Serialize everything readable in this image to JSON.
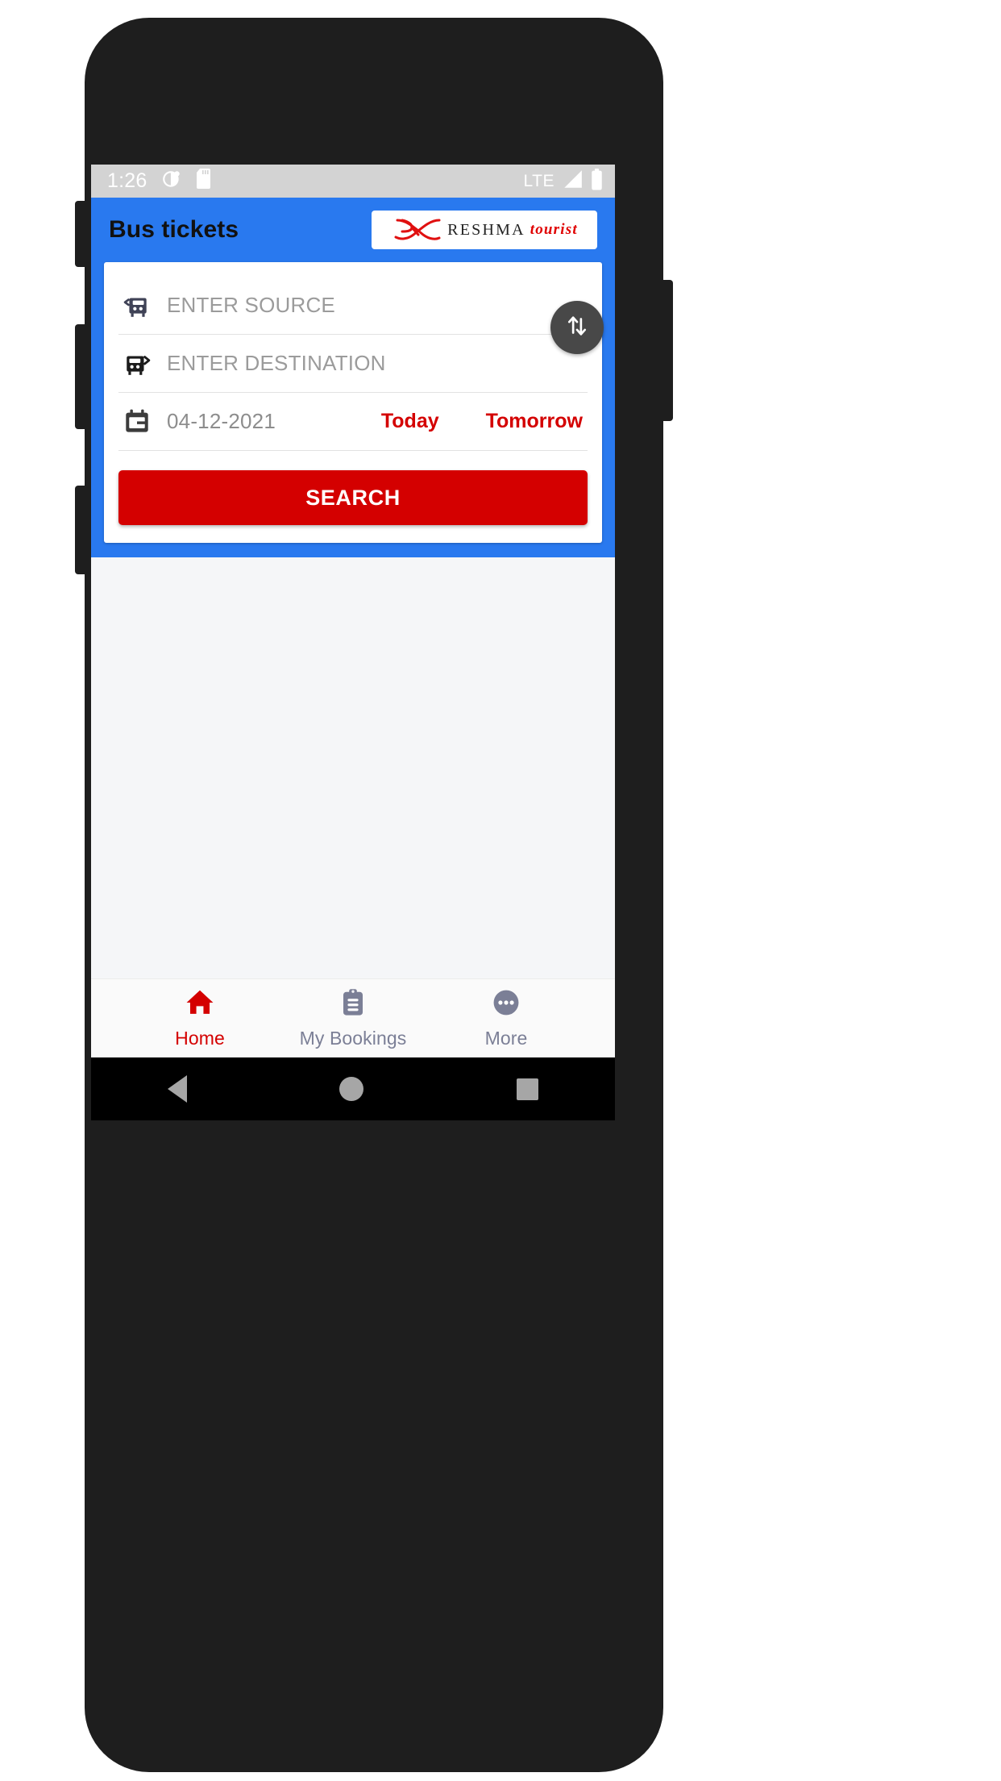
{
  "status_bar": {
    "time": "1:26",
    "network": "LTE",
    "icons": [
      "dnd-icon",
      "sd-card-icon",
      "signal-icon",
      "battery-icon"
    ]
  },
  "app_bar": {
    "title": "Bus tickets",
    "logo": {
      "mark": "reshma-monogram-icon",
      "name": "RESHMA",
      "suffix": "tourist"
    }
  },
  "search_card": {
    "source": {
      "icon": "bus-departure-icon",
      "value": "",
      "placeholder": "ENTER SOURCE"
    },
    "destination": {
      "icon": "bus-arrival-icon",
      "value": "",
      "placeholder": "ENTER DESTINATION"
    },
    "date": {
      "icon": "calendar-icon",
      "value": "04-12-2021"
    },
    "quick_dates": [
      {
        "label": "Today"
      },
      {
        "label": "Tomorrow"
      }
    ],
    "swap_button": {
      "icon": "swap-vertical-icon"
    },
    "search_button": {
      "label": "SEARCH"
    }
  },
  "bottom_nav": {
    "items": [
      {
        "label": "Home",
        "icon": "home-icon",
        "active": true
      },
      {
        "label": "My Bookings",
        "icon": "clipboard-icon",
        "active": false
      },
      {
        "label": "More",
        "icon": "more-dots-icon",
        "active": false
      }
    ]
  },
  "android_nav": {
    "back": "back-triangle-icon",
    "home": "home-circle-icon",
    "recents": "recents-square-icon"
  },
  "colors": {
    "primary_blue": "#2979ef",
    "accent_red": "#d40000",
    "status_bar": "#d3d3d3",
    "body_bg": "#f5f6f8",
    "nav_inactive": "#7b7f96"
  }
}
